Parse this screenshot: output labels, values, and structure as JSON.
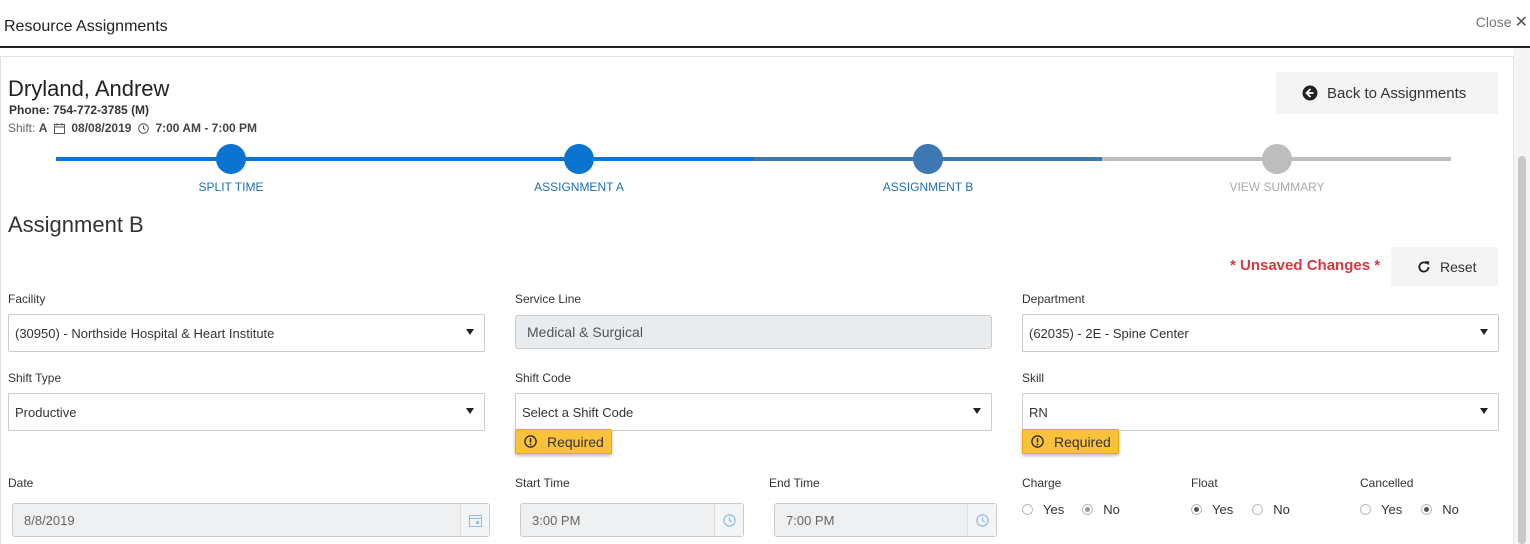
{
  "window": {
    "title": "Resource Assignments",
    "close_label": "Close"
  },
  "person": {
    "name": "Dryland, Andrew",
    "phone": "Phone: 754-772-3785 (M)",
    "shift_prefix": "Shift:",
    "shift_code": "A",
    "date": "08/08/2019",
    "time": "7:00 AM - 7:00 PM"
  },
  "back_button_label": "Back to Assignments",
  "stepper": {
    "steps": [
      {
        "label": "SPLIT TIME",
        "state": "complete"
      },
      {
        "label": "ASSIGNMENT A",
        "state": "complete"
      },
      {
        "label": "ASSIGNMENT B",
        "state": "active"
      },
      {
        "label": "VIEW SUMMARY",
        "state": "pending"
      }
    ],
    "colors": {
      "complete": "#0a74d0",
      "active": "#3d78b2",
      "pending": "#bdbdbd",
      "complete_label": "#1c6fb7",
      "pending_label": "#aaaaaa"
    }
  },
  "section_title": "Assignment B",
  "unsaved_label": "* Unsaved Changes *",
  "reset_label": "Reset",
  "form": {
    "facility": {
      "label": "Facility",
      "value": "(30950) - Northside Hospital & Heart Institute"
    },
    "service_line": {
      "label": "Service Line",
      "value": "Medical & Surgical"
    },
    "department": {
      "label": "Department",
      "value": "(62035) - 2E - Spine Center"
    },
    "shift_type": {
      "label": "Shift Type",
      "value": "Productive"
    },
    "shift_code": {
      "label": "Shift Code",
      "value": "Select a Shift Code",
      "required_label": "Required"
    },
    "skill": {
      "label": "Skill",
      "value": "RN",
      "required_label": "Required"
    },
    "date": {
      "label": "Date",
      "value": "8/8/2019"
    },
    "start_time": {
      "label": "Start Time",
      "value": "3:00 PM"
    },
    "end_time": {
      "label": "End Time",
      "value": "7:00 PM"
    },
    "charge": {
      "label": "Charge",
      "yes": "Yes",
      "no": "No",
      "selected": "No"
    },
    "float": {
      "label": "Float",
      "yes": "Yes",
      "no": "No",
      "selected": "Yes"
    },
    "cancelled": {
      "label": "Cancelled",
      "yes": "Yes",
      "no": "No",
      "selected": "No"
    }
  },
  "icons": {
    "close": "close-icon",
    "calendar": "calendar-icon",
    "clock": "clock-icon",
    "back": "arrow-circle-left-icon",
    "reset": "redo-icon",
    "warning": "exclamation-circle-icon",
    "caret": "caret-down-icon"
  }
}
